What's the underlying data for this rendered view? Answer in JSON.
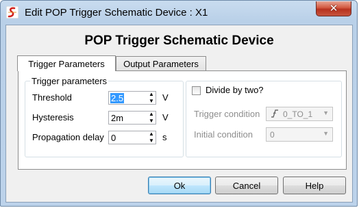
{
  "window": {
    "title": "Edit POP Trigger Schematic Device : X1",
    "close_symbol": "✕",
    "app_icon": "simetrix-logo-icon"
  },
  "heading": "POP Trigger Schematic Device",
  "tabs": [
    {
      "label": "Trigger Parameters",
      "active": true
    },
    {
      "label": "Output Parameters",
      "active": false
    }
  ],
  "trigger_group": {
    "legend": "Trigger parameters",
    "fields": [
      {
        "label": "Threshold",
        "value": "2.5",
        "unit": "V",
        "selected": true
      },
      {
        "label": "Hysteresis",
        "value": "2m",
        "unit": "V"
      },
      {
        "label": "Propagation delay",
        "value": "0",
        "unit": "s"
      }
    ]
  },
  "divide_group": {
    "checkbox_label": "Divide by two?",
    "checked": false,
    "trigger_condition": {
      "label": "Trigger condition",
      "value": "0_TO_1",
      "icon": "rising-edge-icon"
    },
    "initial_condition": {
      "label": "Initial condition",
      "value": "0"
    }
  },
  "buttons": {
    "ok": "Ok",
    "cancel": "Cancel",
    "help": "Help"
  },
  "colors": {
    "accent_blue": "#3399ff",
    "close_red": "#c7412b"
  }
}
